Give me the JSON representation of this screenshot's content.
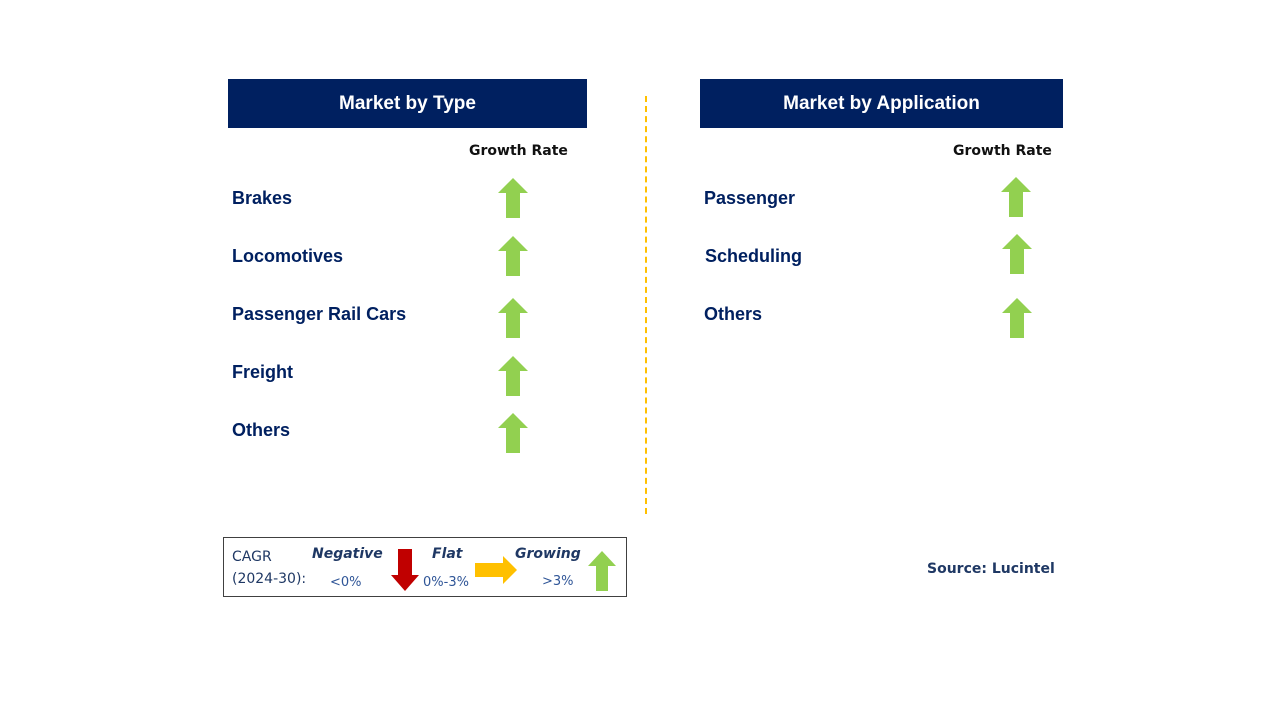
{
  "left_panel": {
    "title": "Market by Type",
    "growth_label": "Growth Rate",
    "rows": [
      {
        "label": "Brakes",
        "trend": "growing"
      },
      {
        "label": "Locomotives",
        "trend": "growing"
      },
      {
        "label": "Passenger Rail Cars",
        "trend": "growing"
      },
      {
        "label": "Freight",
        "trend": "growing"
      },
      {
        "label": "Others",
        "trend": "growing"
      }
    ]
  },
  "right_panel": {
    "title": "Market by Application",
    "growth_label": "Growth Rate",
    "rows": [
      {
        "label": "Passenger",
        "trend": "growing"
      },
      {
        "label": "Scheduling",
        "trend": "growing"
      },
      {
        "label": "Others",
        "trend": "growing"
      }
    ]
  },
  "legend": {
    "cagr_label": "CAGR",
    "period": "(2024-30):",
    "negative": {
      "label": "Negative",
      "range": "<0%",
      "icon": "arrow-down-icon",
      "color": "#C00000"
    },
    "flat": {
      "label": "Flat",
      "range": "0%-3%",
      "icon": "arrow-right-icon",
      "color": "#FFC000"
    },
    "growing": {
      "label": "Growing",
      "range": ">3%",
      "icon": "arrow-up-icon",
      "color": "#92D050"
    }
  },
  "source": "Source: Lucintel",
  "colors": {
    "header": "#002060",
    "divider": "#FFC000",
    "text": "#002060"
  }
}
